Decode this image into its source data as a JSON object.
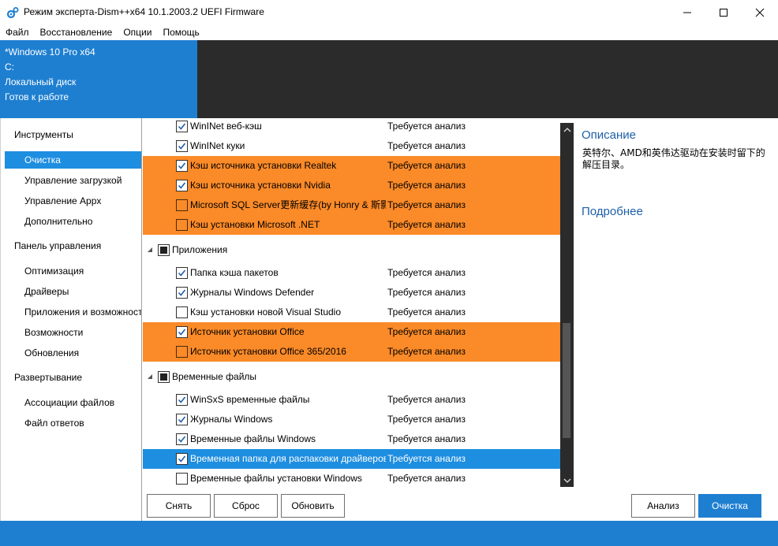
{
  "window": {
    "title": "Режим эксперта-Dism++x64 10.1.2003.2 UEFI Firmware"
  },
  "menu": [
    "Файл",
    "Восстановление",
    "Опции",
    "Помощь"
  ],
  "header": {
    "os": "*Windows 10 Pro x64",
    "drive": "C:",
    "disk": "Локальный диск",
    "status": "Готов к работе"
  },
  "sidebar": {
    "groups": [
      {
        "label": "Инструменты",
        "items": [
          "Очистка",
          "Управление загрузкой",
          "Управление Appx",
          "Дополнительно"
        ]
      },
      {
        "label": "Панель управления",
        "items": [
          "Оптимизация",
          "Драйверы",
          "Приложения и возможности",
          "Возможности",
          "Обновления"
        ]
      },
      {
        "label": "Развертывание",
        "items": [
          "Ассоциации файлов",
          "Файл ответов"
        ]
      }
    ],
    "active": "Очистка"
  },
  "list": {
    "status_text": "Требуется анализ",
    "section1_rows": [
      {
        "label": "WinINet веб-кэш",
        "checked": true,
        "style": "normal"
      },
      {
        "label": "WinINet куки",
        "checked": true,
        "style": "normal"
      },
      {
        "label": "Кэш источника установки Realtek",
        "checked": true,
        "style": "orange"
      },
      {
        "label": "Кэш источника установки Nvidia",
        "checked": true,
        "style": "orange"
      },
      {
        "label": "Microsoft SQL Server更新缓存(by Honry & 斯影)",
        "checked": false,
        "style": "orange"
      },
      {
        "label": "Кэш установки Microsoft .NET",
        "checked": false,
        "style": "orange"
      }
    ],
    "group2": "Приложения",
    "section2_rows": [
      {
        "label": "Папка кэша пакетов",
        "checked": true,
        "style": "normal"
      },
      {
        "label": "Журналы Windows Defender",
        "checked": true,
        "style": "normal"
      },
      {
        "label": "Кэш установки новой Visual Studio",
        "checked": false,
        "style": "normal"
      },
      {
        "label": "Источник установки Office",
        "checked": true,
        "style": "orange"
      },
      {
        "label": "Источник установки Office 365/2016",
        "checked": false,
        "style": "orange"
      }
    ],
    "group3": "Временные файлы",
    "section3_rows": [
      {
        "label": "WinSxS временные файлы",
        "checked": true,
        "style": "normal"
      },
      {
        "label": "Журналы Windows",
        "checked": true,
        "style": "normal"
      },
      {
        "label": "Временные файлы Windows",
        "checked": true,
        "style": "normal"
      },
      {
        "label": "Временная папка для распаковки драйверов",
        "checked": true,
        "style": "blue"
      },
      {
        "label": "Временные файлы установки Windows",
        "checked": false,
        "style": "normal"
      }
    ]
  },
  "description": {
    "title": "Описание",
    "text": "英特尔、AMD和英伟达驱动在安装时留下的解压目录。",
    "more": "Подробнее"
  },
  "buttons": {
    "remove": "Снять",
    "reset": "Сброс",
    "refresh": "Обновить",
    "analyze": "Анализ",
    "clean": "Очистка"
  },
  "colors": {
    "accent": "#1e7fd1",
    "orange": "#fb8a28",
    "selected": "#1e8ee0",
    "dark": "#2b2b2b"
  }
}
